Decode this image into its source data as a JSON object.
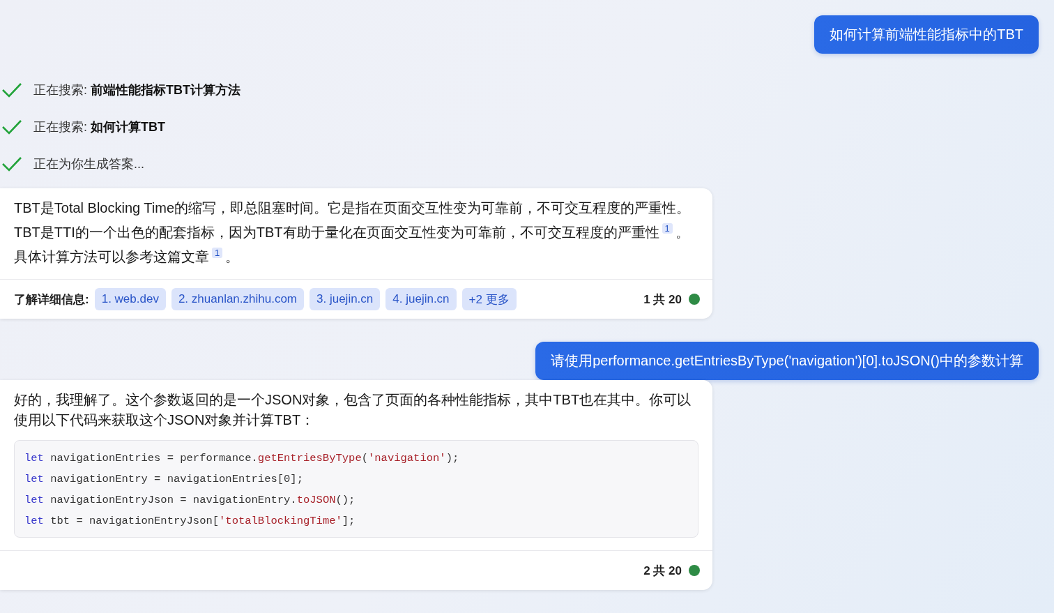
{
  "messages": [
    {
      "kind": "user",
      "text": "如何计算前端性能指标中的TBT"
    },
    {
      "kind": "steps",
      "steps": [
        {
          "text": "正在搜索: **前端性能指标TBT计算方法**",
          "done": true
        },
        {
          "text": "正在搜索: **如何计算TBT**",
          "done": true
        },
        {
          "text": "正在为你生成答案...",
          "done": true
        }
      ]
    },
    {
      "kind": "answer",
      "paragraph": "TBT是Total Blocking Time的缩写，即总阻塞时间。它是指在页面交互性变为可靠前，不可交互程度的严重性。TBT是TTI的一个出色的配套指标，因为TBT有助于量化在页面交互性变为可靠前，不可交互程度的严重性$^{1}$。具体计算方法可以参考这篇文章$^{1}$。",
      "learn_more": {
        "label": "了解详细信息:",
        "links": [
          "1. web.dev",
          "2. zhuanlan.zhihu.com",
          "3. juejin.cn",
          "4. juejin.cn",
          "+2 更多"
        ]
      },
      "counter": "1 共 20"
    },
    {
      "kind": "user",
      "text": "请使用performance.getEntriesByType('navigation')[0].toJSON()中的参数计算"
    },
    {
      "kind": "answer",
      "paragraph": "好的，我理解了。这个参数返回的是一个JSON对象，包含了页面的各种性能指标，其中TBT也在其中。你可以使用以下代码来获取这个JSON对象并计算TBT：",
      "code": [
        [
          {
            "kind": "keyword",
            "text": "let"
          },
          {
            "kind": "plain",
            "text": " navigationEntries = performance."
          },
          {
            "kind": "func",
            "text": "getEntriesByType"
          },
          {
            "kind": "plain",
            "text": "("
          },
          {
            "kind": "string",
            "text": "'navigation'"
          },
          {
            "kind": "plain",
            "text": ");"
          }
        ],
        [
          {
            "kind": "keyword",
            "text": "let"
          },
          {
            "kind": "plain",
            "text": " navigationEntry = navigationEntries[0];"
          }
        ],
        [
          {
            "kind": "keyword",
            "text": "let"
          },
          {
            "kind": "plain",
            "text": " navigationEntryJson = navigationEntry."
          },
          {
            "kind": "func",
            "text": "toJSON"
          },
          {
            "kind": "plain",
            "text": "();"
          }
        ],
        [
          {
            "kind": "keyword",
            "text": "let"
          },
          {
            "kind": "plain",
            "text": " tbt = navigationEntryJson["
          },
          {
            "kind": "string",
            "text": "'totalBlockingTime'"
          },
          {
            "kind": "plain",
            "text": "];"
          }
        ]
      ],
      "counter": "2 共 20"
    }
  ]
}
